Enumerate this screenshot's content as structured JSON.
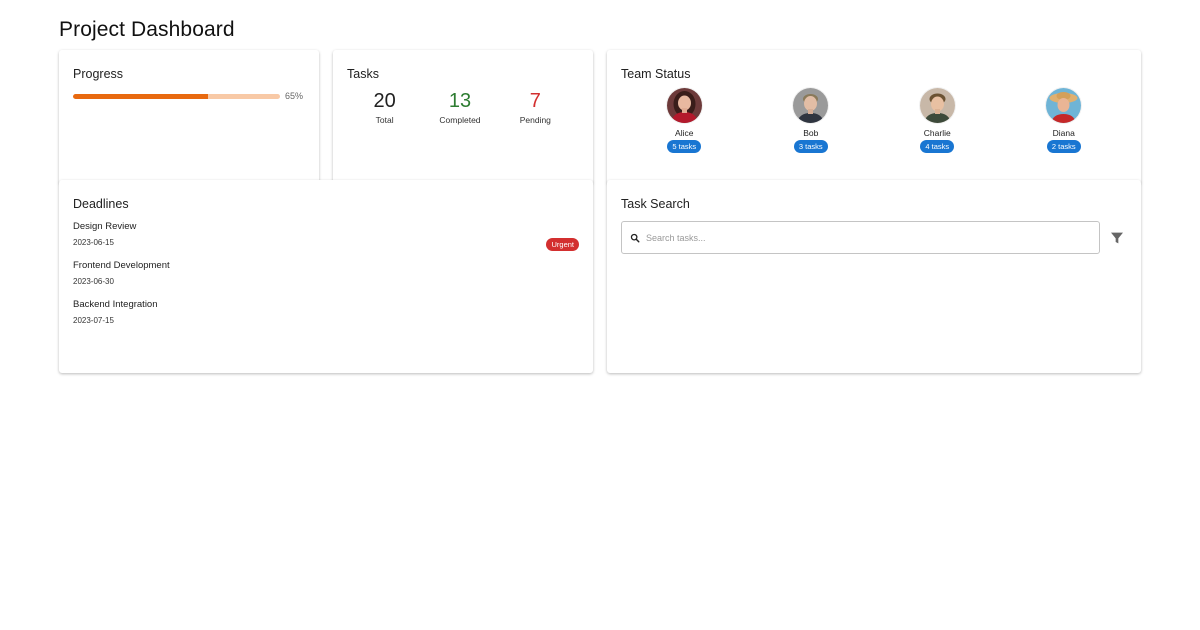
{
  "page": {
    "title": "Project Dashboard"
  },
  "progress": {
    "title": "Progress",
    "value": 0.65,
    "label": "65%",
    "fill_color": "#e8690f",
    "track_color": "#f8c9a6"
  },
  "tasks": {
    "title": "Tasks",
    "total": {
      "value": "20",
      "label": "Total"
    },
    "completed": {
      "value": "13",
      "label": "Completed"
    },
    "pending": {
      "value": "7",
      "label": "Pending"
    }
  },
  "team": {
    "title": "Team Status",
    "members": [
      {
        "name": "Alice",
        "tasks": "5 tasks"
      },
      {
        "name": "Bob",
        "tasks": "3 tasks"
      },
      {
        "name": "Charlie",
        "tasks": "4 tasks"
      },
      {
        "name": "Diana",
        "tasks": "2 tasks"
      }
    ]
  },
  "deadlines": {
    "title": "Deadlines",
    "items": [
      {
        "name": "Design Review",
        "date": "2023-06-15",
        "badge": "Urgent"
      },
      {
        "name": "Frontend Development",
        "date": "2023-06-30"
      },
      {
        "name": "Backend Integration",
        "date": "2023-07-15"
      }
    ]
  },
  "search": {
    "title": "Task Search",
    "placeholder": "Search tasks...",
    "value": "",
    "search_icon": "search-icon",
    "filter_icon": "filter-icon"
  },
  "colors": {
    "primary": "#1976d2",
    "success": "#2e7d32",
    "danger": "#d32f2f"
  }
}
